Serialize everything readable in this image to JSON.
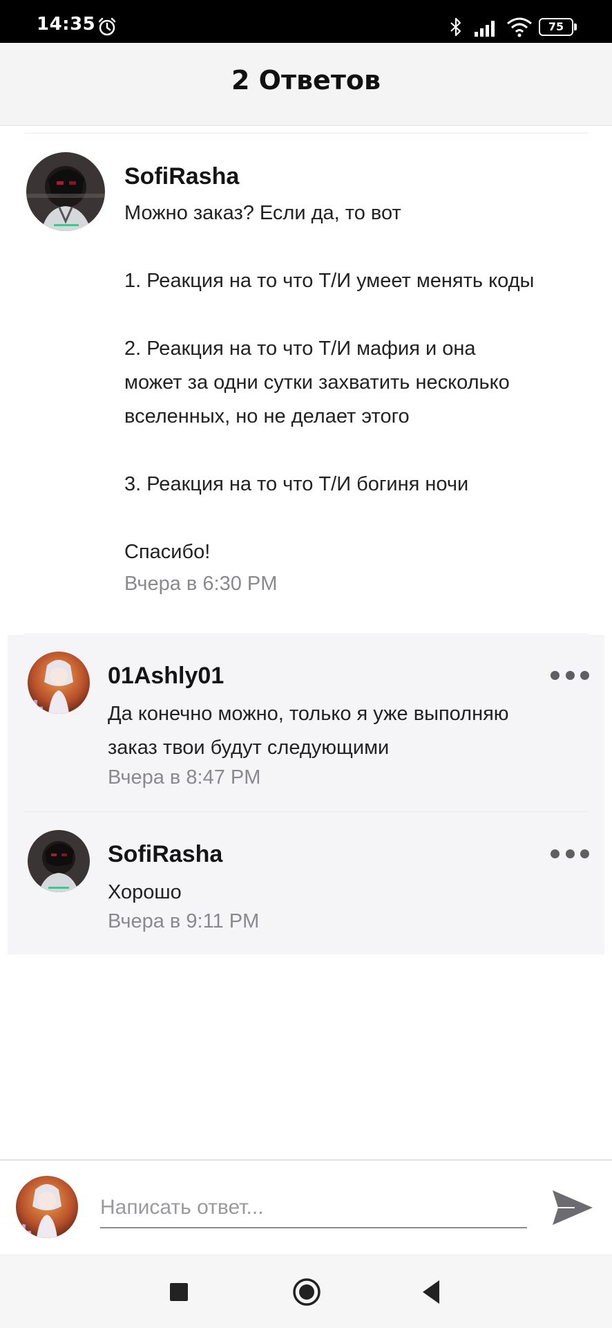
{
  "status_bar": {
    "time": "14:35",
    "battery_level": "75",
    "icons": [
      "alarm-icon",
      "bluetooth-icon",
      "signal-icon",
      "wifi-icon",
      "battery-icon"
    ]
  },
  "header": {
    "title": "2 Ответов"
  },
  "original_comment": {
    "author": "SofiRasha",
    "lines": [
      "Можно заказ? Если да, то вот",
      "1. Реакция на то что Т/И умеет менять коды",
      "2. Реакция на то что Т/И мафия и она",
      "может за одни сутки захватить несколько",
      "вселенных, но не делает этого",
      "3. Реакция на то что Т/И богиня ночи",
      "Спасибо!"
    ],
    "timestamp": "Вчера в 6:30 PM"
  },
  "replies": [
    {
      "author": "01Ashly01",
      "lines": [
        "Да конечно можно, только я уже выполняю",
        "заказ твои будут следующими"
      ],
      "timestamp": "Вчера в 8:47 PM",
      "more_icon": "more-horizontal-icon"
    },
    {
      "author": "SofiRasha",
      "lines": [
        "Хорошо"
      ],
      "timestamp": "Вчера в 9:11 PM",
      "more_icon": "more-horizontal-icon"
    }
  ],
  "reply_bar": {
    "placeholder": "Написать ответ...",
    "value": "",
    "send_icon": "send-icon"
  },
  "nav_bar": {
    "icons": [
      "recent-apps-icon",
      "home-icon",
      "back-icon"
    ]
  },
  "colors": {
    "header_bg": "#f4f4f5",
    "reply_bg": "#f5f4f7",
    "timestamp": "#8a8a8e",
    "text": "#1a1a1a"
  }
}
